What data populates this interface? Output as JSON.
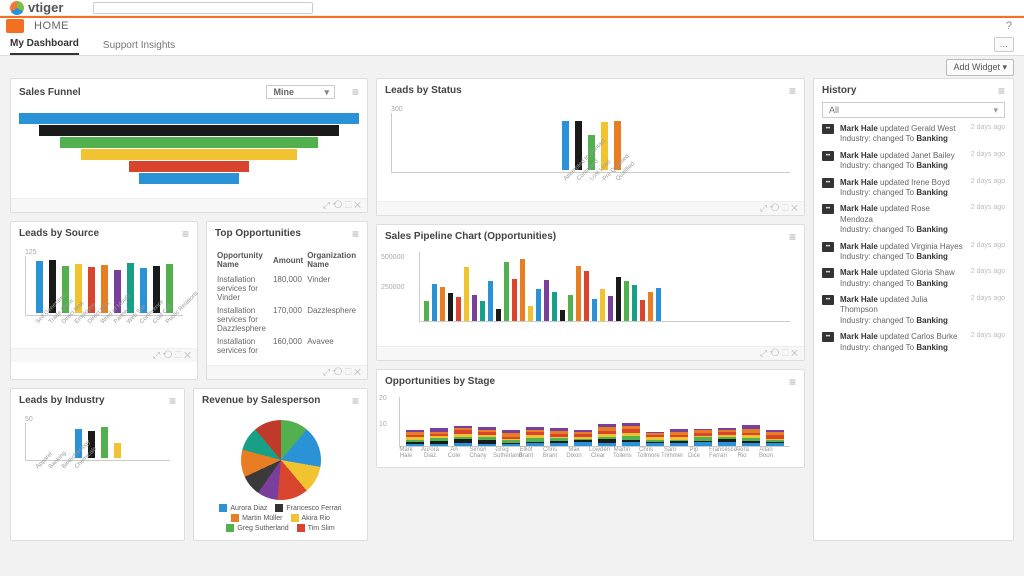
{
  "brand": "vtiger",
  "module": "HOME",
  "tabs": {
    "active": "My Dashboard",
    "items": [
      "My Dashboard",
      "Support Insights"
    ]
  },
  "more_label": "...",
  "add_widget_label": "Add Widget ▾",
  "cards": {
    "funnel": {
      "title": "Sales Funnel",
      "filter": "Mine"
    },
    "leads_status": {
      "title": "Leads by Status"
    },
    "history": {
      "title": "History",
      "filter": "All"
    },
    "leads_source": {
      "title": "Leads by Source"
    },
    "top_opps": {
      "title": "Top Opportunities",
      "cols": [
        "Opportunity Name",
        "Amount",
        "Organization Name"
      ]
    },
    "pipeline": {
      "title": "Sales Pipeline Chart (Opportunities)"
    },
    "leads_industry": {
      "title": "Leads by Industry"
    },
    "revenue_sp": {
      "title": "Revenue by Salesperson"
    },
    "opps_stage": {
      "title": "Opportunities by Stage"
    }
  },
  "top_opps_rows": [
    {
      "name": "Installation services for Vinder",
      "amount": "180,000",
      "org": "Vinder"
    },
    {
      "name": "Installation services for Dazzlesphere",
      "amount": "170,000",
      "org": "Dazzlesphere"
    },
    {
      "name": "Installation services for",
      "amount": "160,000",
      "org": "Avavee"
    }
  ],
  "history_actor": "Mark Hale",
  "history_verb": "updated",
  "history_field": "Industry",
  "history_to": "Banking",
  "history_time": "2 days ago",
  "history_targets": [
    "Gerald West",
    "Janet Bailey",
    "Irene Boyd",
    "Rose Mendoza",
    "Virginia Hayes",
    "Gloria Shaw",
    "Julia Thompson",
    "Carlos Burke"
  ],
  "salespeople": [
    "Aurora Diaz",
    "Francesco Ferrari",
    "Martin Müller",
    "Akira Rio",
    "Greg Sutherland",
    "Tim Slim"
  ],
  "salespeople_colors": [
    "#2a92d6",
    "#333333",
    "#e77e23",
    "#f2c331",
    "#52b04f",
    "#d9442f"
  ],
  "stage_names": [
    "Mark Hale",
    "Aurora Diaz",
    "An Cole",
    "Simon Chany",
    "Greg Sutherland",
    "Elliot Brant",
    "Chris Brant",
    "Max Dixon",
    "Lowden Clear",
    "Martin Tollens",
    "Chris Tollmore",
    "Sam Trimmer",
    "Pip Dice",
    "Francesco Ferrari",
    "Akira Rio",
    "Allan Boon"
  ],
  "chart_data": [
    {
      "id": "funnel",
      "type": "funnel",
      "colors": [
        "#2a92d6",
        "#1a1a1a",
        "#52b04f",
        "#f2c331",
        "#d9442f",
        "#2a92d6"
      ],
      "widths": [
        340,
        300,
        258,
        216,
        120,
        100
      ]
    },
    {
      "id": "leads_status",
      "type": "bar",
      "ylim": [
        0,
        300
      ],
      "categories": [
        "Attempted to Contact",
        "Contacted",
        "Lost Lead",
        "Pre Qualified",
        "Qualified"
      ],
      "values": [
        260,
        265,
        190,
        255,
        260
      ],
      "colors": [
        "#2a92d6",
        "#1a1a1a",
        "#52b04f",
        "#f2c331",
        "#e77e23"
      ]
    },
    {
      "id": "leads_source",
      "type": "bar",
      "ylim": [
        0,
        125
      ],
      "ytick": 125,
      "categories": [
        "Self Generated",
        "Trade Show",
        "Direct Mail",
        "Employee",
        "Direct Mail",
        "Word of Mouth",
        "Partner",
        "Web Site",
        "Conference",
        "Cold Call",
        "Public Relations"
      ],
      "values": [
        115,
        118,
        105,
        110,
        102,
        108,
        95,
        112,
        100,
        104,
        110
      ],
      "colors": [
        "#2a92d6",
        "#1a1a1a",
        "#52b04f",
        "#f2c331",
        "#d9442f",
        "#e77e23",
        "#7a3f9d",
        "#17a085",
        "#2a92d6",
        "#1a1a1a",
        "#52b04f"
      ]
    },
    {
      "id": "pipeline",
      "type": "bar",
      "ylim": [
        0,
        500000
      ],
      "yticks": [
        "500000",
        "250000"
      ],
      "count": 30,
      "values": [
        150000,
        280000,
        260000,
        210000,
        180000,
        410000,
        200000,
        150000,
        300000,
        90000,
        450000,
        320000,
        470000,
        110000,
        240000,
        310000,
        220000,
        80000,
        200000,
        420000,
        380000,
        170000,
        240000,
        190000,
        330000,
        300000,
        270000,
        160000,
        220000,
        250000
      ],
      "colors": [
        "#52b04f",
        "#2a92d6",
        "#e77e23",
        "#1a1a1a",
        "#d9442f",
        "#f2c331",
        "#7a3f9d",
        "#17a085",
        "#2a92d6",
        "#1a1a1a",
        "#52b04f",
        "#d9442f",
        "#e77e23",
        "#f2c331",
        "#2a92d6",
        "#7a3f9d",
        "#17a085",
        "#1a1a1a",
        "#52b04f",
        "#e77e23",
        "#d9442f",
        "#2a92d6",
        "#f2c331",
        "#7a3f9d",
        "#1a1a1a",
        "#52b04f",
        "#17a085",
        "#d9442f",
        "#e77e23",
        "#2a92d6"
      ]
    },
    {
      "id": "leads_industry",
      "type": "bar",
      "ylim": [
        0,
        50
      ],
      "ytick": 50,
      "categories": [
        "Apparel",
        "Banking",
        "Biotechnology",
        "Chemicals"
      ],
      "values": [
        42,
        40,
        45,
        22
      ],
      "colors": [
        "#2a92d6",
        "#1a1a1a",
        "#52b04f",
        "#f2c331"
      ]
    },
    {
      "id": "revenue_sp",
      "type": "pie"
    },
    {
      "id": "opps_stage",
      "type": "stacked-bar",
      "ylim": [
        0,
        20
      ],
      "yticks": [
        "20",
        "10"
      ],
      "stacks_per_cat": 7,
      "stack_colors": [
        "#2a92d6",
        "#1a1a1a",
        "#52b04f",
        "#f2c331",
        "#d9442f",
        "#e77e23",
        "#7a3f9d"
      ]
    }
  ]
}
